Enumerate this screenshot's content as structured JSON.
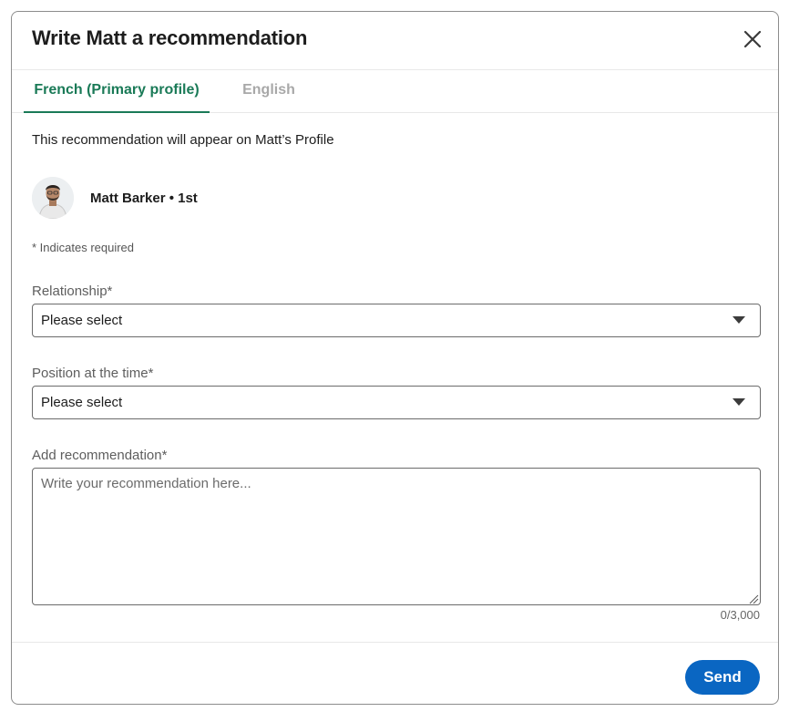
{
  "modal": {
    "title": "Write Matt a recommendation",
    "close_icon": "close-icon"
  },
  "tabs": [
    {
      "label": "French (Primary profile)",
      "active": true
    },
    {
      "label": "English",
      "active": false
    }
  ],
  "notice": "This recommendation will appear on Matt’s Profile",
  "person": {
    "name_line": "Matt Barker • 1st",
    "avatar_icon": "avatar"
  },
  "required_note": "* Indicates required",
  "fields": {
    "relationship": {
      "label": "Relationship*",
      "value": "Please select"
    },
    "position": {
      "label": "Position at the time*",
      "value": "Please select"
    },
    "recommendation": {
      "label": "Add recommendation*",
      "placeholder": "Write your recommendation here...",
      "value": "",
      "counter": "0/3,000"
    }
  },
  "footer": {
    "send_label": "Send"
  },
  "colors": {
    "accent_green": "#1a7a57",
    "primary_blue": "#0a66c2",
    "inactive_tab": "#a8a8a8",
    "border": "#6b6b6b"
  }
}
